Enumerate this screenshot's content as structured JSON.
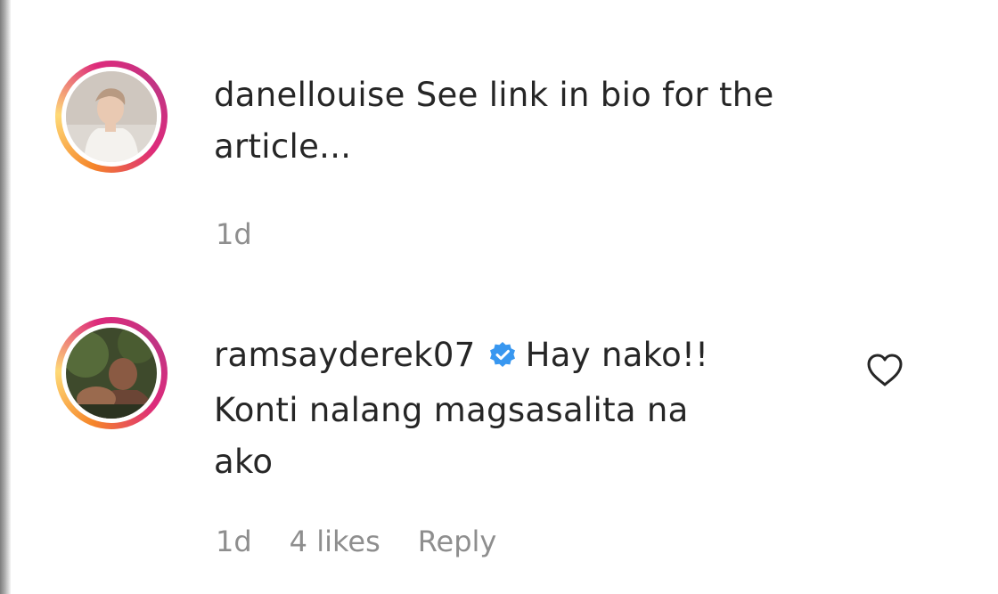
{
  "comments": [
    {
      "username": "danellouise",
      "text": "See link in bio for the",
      "text_line2": "article...",
      "time": "1d",
      "avatar": "profile-photo-light"
    },
    {
      "username": "ramsayderek07",
      "verified": true,
      "text": "Hay nako!!",
      "text_line2": "Konti nalang magsasalita na",
      "text_line3": "ako",
      "time": "1d",
      "likes": "4 likes",
      "reply_label": "Reply",
      "avatar": "profile-photo-dark"
    }
  ],
  "icons": {
    "verified": "verified-badge-icon",
    "like": "heart-icon"
  },
  "colors": {
    "text": "#262626",
    "muted": "#8e8e8e",
    "verified": "#3897f0",
    "ring_start": "#f58529",
    "ring_end": "#dd2a7b"
  }
}
